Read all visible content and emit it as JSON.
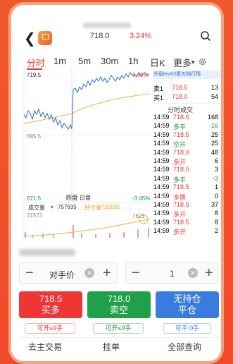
{
  "header": {
    "price": "718.0",
    "change_pct": "3.24%"
  },
  "tabs": [
    {
      "label": "分时",
      "active": true
    },
    {
      "label": "1m"
    },
    {
      "label": "5m"
    },
    {
      "label": "30m"
    },
    {
      "label": "1h"
    },
    {
      "label": "日K"
    },
    {
      "label": "更多"
    }
  ],
  "chart": {
    "price_high": "719.5",
    "price_mid": "695.5",
    "price_low": "671.5",
    "pct_high": "3.45%",
    "pct_low": "-3.45%",
    "banner": "升级level2看五档行情",
    "legend_yesterday": "昨盘",
    "legend_today": "日盘",
    "vol_label": "成交量",
    "vol_value": "757635",
    "oi_label": "持仓量",
    "oi_value": "752035",
    "vol_axis": "21573",
    "vol_right": "7621"
  },
  "orderbook": {
    "sell1_label": "卖1",
    "sell1_price": "718.5",
    "sell1_qty": "13",
    "buy1_label": "买1",
    "buy1_price": "718.0",
    "buy1_qty": "54",
    "trades_title": "分时成交"
  },
  "trades": [
    {
      "time": "14:59",
      "price": "718.5",
      "qty": "168",
      "type": ""
    },
    {
      "time": "14:59",
      "price": "多平",
      "qty": "-16",
      "type": ""
    },
    {
      "time": "14:59",
      "price": "718.5",
      "qty": "25",
      "type": ""
    },
    {
      "time": "14:59",
      "price": "空开",
      "qty": "25",
      "type": ""
    },
    {
      "time": "14:59",
      "price": "718.0",
      "qty": "48",
      "type": ""
    },
    {
      "time": "14:59",
      "price": "多开",
      "qty": "6",
      "type": ""
    },
    {
      "time": "14:59",
      "price": "718.0",
      "qty": "3",
      "type": ""
    },
    {
      "time": "14:59",
      "price": "多平",
      "qty": "-3",
      "type": ""
    },
    {
      "time": "14:59",
      "price": "718.5",
      "qty": "1",
      "type": ""
    },
    {
      "time": "14:59",
      "price": "多换",
      "qty": "0",
      "type": ""
    },
    {
      "time": "14:59",
      "price": "718.5",
      "qty": "37",
      "type": ""
    },
    {
      "time": "14:59",
      "price": "多开",
      "qty": "8",
      "type": ""
    },
    {
      "time": "14:59",
      "price": "718.5",
      "qty": "8",
      "type": ""
    },
    {
      "time": "14:59",
      "price": "多开",
      "qty": "2",
      "type": ""
    }
  ],
  "trade_panel": {
    "price_mode": "对手价",
    "qty": "1",
    "buy_price": "718.5",
    "buy_label": "买多",
    "sell_price": "718.0",
    "sell_label": "卖空",
    "close_label1": "无持仓",
    "close_label2": "平仓",
    "buy_cap": "可开≤9手",
    "sell_cap": "可开≤9手",
    "close_cap": "可平:0手",
    "nav_trade": "去主交易",
    "nav_orders": "挂单",
    "nav_query": "全部查询"
  },
  "colors": {
    "up": "#e33333",
    "down": "#1a9a3a",
    "close": "#3a7be0",
    "accent": "#e53a2a"
  }
}
